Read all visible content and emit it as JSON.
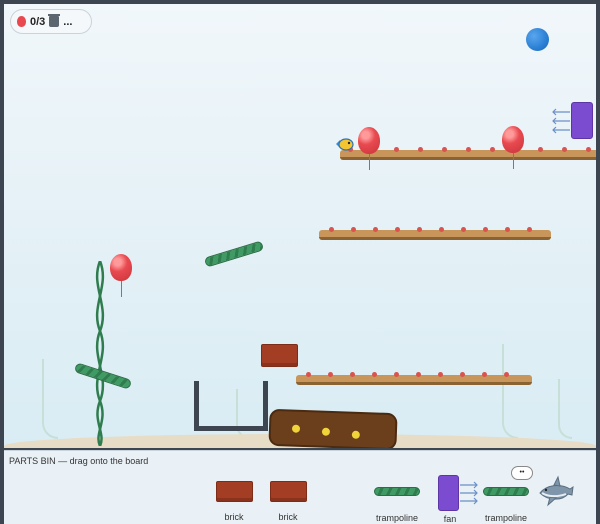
{
  "hud": {
    "score": "0/3",
    "tools": "..."
  },
  "colors": {
    "balloon": "#e84a50",
    "trampoline": "#3f9a63",
    "brick": "#a33d24",
    "fan": "#7b4bd0",
    "shelf": "#c8955a",
    "ball": "#2a7fd4"
  },
  "bin": {
    "title": "PARTS BIN — drag onto the board",
    "items": [
      {
        "label": "brick"
      },
      {
        "label": "brick"
      },
      {
        "label": "trampoline"
      },
      {
        "label": "fan"
      },
      {
        "label": "trampoline"
      }
    ],
    "speech": "••"
  }
}
